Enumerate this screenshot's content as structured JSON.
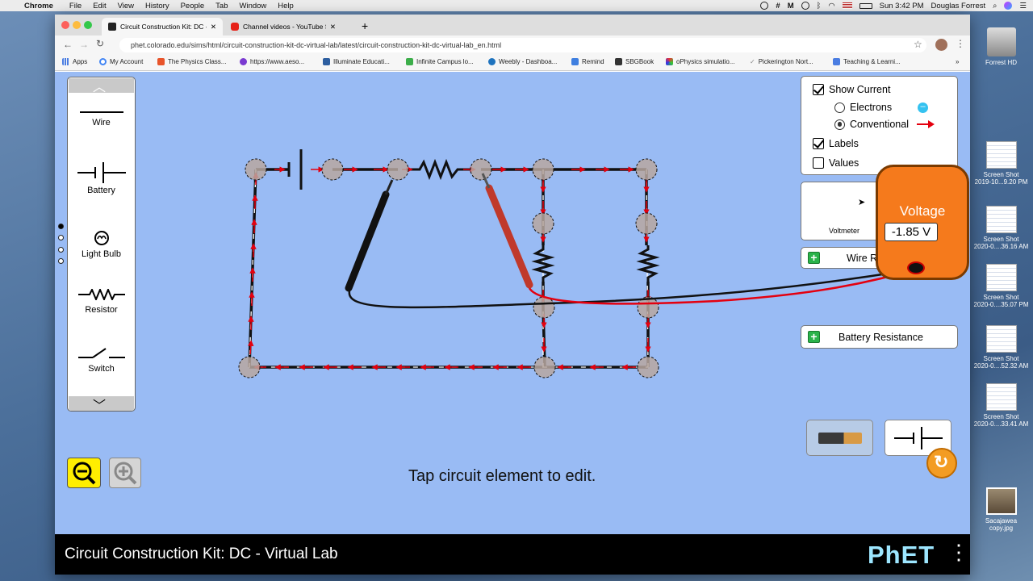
{
  "menubar": {
    "app": "Chrome",
    "items": [
      "File",
      "Edit",
      "View",
      "History",
      "People",
      "Tab",
      "Window",
      "Help"
    ],
    "clock": "Sun 3:42 PM",
    "user": "Douglas Forrest"
  },
  "browser": {
    "tabs": [
      {
        "title": "Circuit Construction Kit: DC - V",
        "active": true
      },
      {
        "title": "Channel videos - YouTube Stud",
        "active": false
      }
    ],
    "new_tab": "+",
    "url": "phet.colorado.edu/sims/html/circuit-construction-kit-dc-virtual-lab/latest/circuit-construction-kit-dc-virtual-lab_en.html",
    "bookmarks": [
      "Apps",
      "My Account",
      "The Physics Class...",
      "https://www.aeso...",
      "Illuminate Educati...",
      "Infinite Campus lo...",
      "Weebly - Dashboa...",
      "Remind",
      "SBGBook",
      "oPhysics simulatio...",
      "Pickerington Nort...",
      "Teaching & Learni..."
    ],
    "more": "»"
  },
  "toolbox": {
    "items": [
      "Wire",
      "Battery",
      "Light Bulb",
      "Resistor",
      "Switch"
    ]
  },
  "options_panel": {
    "show_current": "Show Current",
    "electrons": "Electrons",
    "conventional": "Conventional",
    "labels": "Labels",
    "values": "Values",
    "show_current_checked": true,
    "mode": "conventional",
    "labels_checked": true,
    "values_checked": false
  },
  "voltmeter_panel": {
    "label": "Voltmeter"
  },
  "wire_resistivity": {
    "label": "Wire Resistivity"
  },
  "battery_resistance": {
    "label": "Battery Resistance"
  },
  "voltmeter": {
    "title": "Voltage",
    "reading": "-1.85 V"
  },
  "hint": "Tap circuit element to edit.",
  "footer": {
    "title": "Circuit Construction Kit: DC - Virtual Lab",
    "logo": "PhET"
  },
  "colors": {
    "current_arrow": "#e4000f",
    "sim_bg": "#99bbf4",
    "meter_body": "#f57a1c"
  },
  "desktop": {
    "drive": "Forrest HD",
    "files": [
      {
        "name": "Screen Shot",
        "sub": "2019-10...9.20 PM"
      },
      {
        "name": "Screen Shot",
        "sub": "2020-0....36.16 AM"
      },
      {
        "name": "Screen Shot",
        "sub": "2020-0....35.07 PM"
      },
      {
        "name": "Screen Shot",
        "sub": "2020-0....52.32 AM"
      },
      {
        "name": "Screen Shot",
        "sub": "2020-0....33.41 AM"
      },
      {
        "name": "Sacajawea",
        "sub": "copy.jpg"
      }
    ]
  }
}
